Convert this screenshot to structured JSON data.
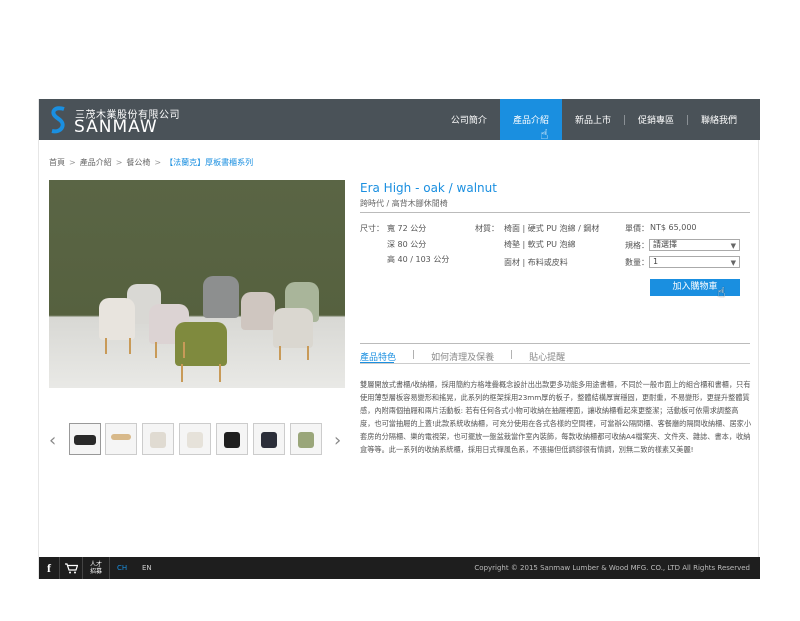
{
  "brand": {
    "name_cn": "三茂木業股份有限公司",
    "name_en": "SANMAW"
  },
  "nav": {
    "items": [
      {
        "label": "公司簡介"
      },
      {
        "label": "產品介紹"
      },
      {
        "label": "新品上市"
      },
      {
        "label": "促銷專區"
      },
      {
        "label": "聯絡我們"
      }
    ],
    "active_index": 1
  },
  "breadcrumb": {
    "items": [
      "首頁",
      "產品介紹",
      "餐公椅"
    ],
    "current": "【法蘭克】厚板書櫃系列",
    "separator": ">"
  },
  "product": {
    "title": "Era High - oak / walnut",
    "subtitle": "跨時代 / 高背木腳休閒椅",
    "size_label": "尺寸：",
    "size_width": "寬 72 公分",
    "size_depth": "深 80 公分",
    "size_height": "高 40 / 103 公分",
    "material_label": "材質：",
    "materials": [
      "椅面 | 硬式 PU 泡綿 / 鋼材",
      "椅墊 | 軟式 PU 泡綿",
      "面材 | 布料或皮料"
    ],
    "price_label": "單價：",
    "price_value": "NT$ 65,000",
    "spec_label": "規格：",
    "spec_value": "請選擇",
    "qty_label": "數量：",
    "qty_value": "1",
    "add_to_cart": "加入購物車"
  },
  "tabs": {
    "items": [
      "產品特色",
      "如何清理及保養",
      "貼心提醒"
    ],
    "separator": "|",
    "active_index": 0
  },
  "description": "雙層開放式書櫃/收納櫃，採用簡約方格堆疊概念設計出出款更多功能多用途書櫃，不同於一般市面上的組合櫃和書櫃，只有使用薄型層板容易變形和搖晃，此系列的框架採用23mm厚的板子，整體結構厚實穩固，更耐重，不易變形，更提升整體質感，內附兩個抽屜和兩片活動板: 若有任何各式小物可收納在抽屜裡面，讓收納櫃看起來更整潔；活動板可依需求調整高度，也可當抽屜的上蓋!此款系統收納櫃，可充分使用在各式各樣的空間裡，可當辦公隔間櫃、客餐廳的隔間收納櫃、居家小套房的分隔櫃、樂的電視架，也可擺放一盤盆栽當作室內裝飾，每款收納櫃都可收納A4檔案夾、文件夾、雜誌、書本，收納盒等等。此一系列的收納系統櫃，採用日式禪風色系，不張揚但低調卻很有情調，別無二致的樣素又美麗!",
  "gallery": {
    "thumbs": [
      {
        "icon": "sofa-black-thumb",
        "color": "#2a2a2a"
      },
      {
        "icon": "table-wood-thumb",
        "color": "#d8b98a"
      },
      {
        "icon": "chair-white-thumb",
        "color": "#e8e4dc"
      },
      {
        "icon": "chair-wood-thumb",
        "color": "#efece6"
      },
      {
        "icon": "chair-black-thumb",
        "color": "#1f1f1f"
      },
      {
        "icon": "chair-navy-thumb",
        "color": "#2c2f3a"
      },
      {
        "icon": "chair-green-thumb",
        "color": "#9aa67a"
      }
    ]
  },
  "footer": {
    "recruit_label": "人才招募",
    "lang_ch": "CH",
    "lang_en": "EN",
    "copyright": "Copyright © 2015 Sanmaw Lumber & Wood MFG. CO., LTD All Rights Reserved"
  },
  "colors": {
    "accent": "#1a8fe0",
    "header_bg": "#4a5258",
    "footer_bg": "#1e1e1e"
  }
}
